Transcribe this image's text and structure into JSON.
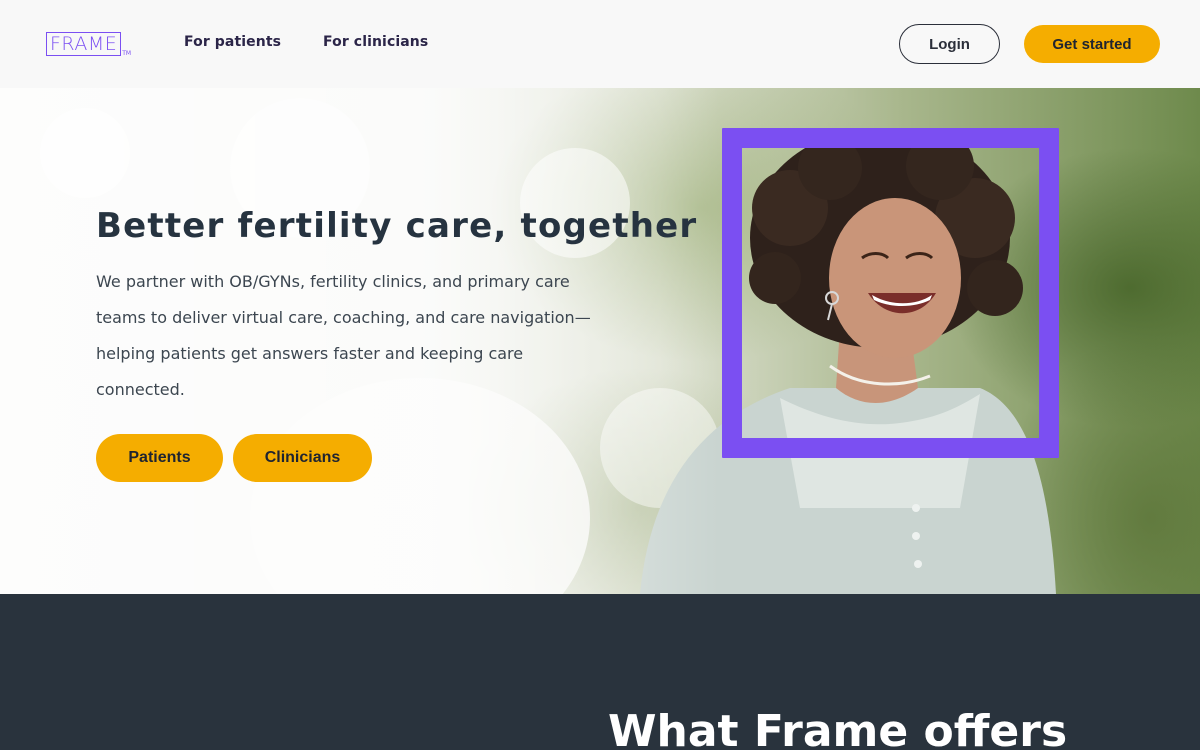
{
  "brand": {
    "logo_text": "FRAME",
    "logo_tm": "TM"
  },
  "nav": {
    "patients_label": "For patients",
    "clinicians_label": "For clinicians",
    "login_label": "Login",
    "get_started_label": "Get started"
  },
  "hero": {
    "title": "Better fertility care, together",
    "description": "We partner with OB/GYNs, fertility clinics, and primary care teams to deliver virtual care, coaching, and care navigation—helping patients get answers faster and keeping care connected.",
    "patients_button": "Patients",
    "clinicians_button": "Clinicians"
  },
  "offers": {
    "title": "What Frame offers"
  },
  "colors": {
    "accent_purple": "#7b4ff2",
    "cta_yellow": "#f5ad00",
    "dark_section": "#29333d",
    "heading_text": "#263340"
  }
}
